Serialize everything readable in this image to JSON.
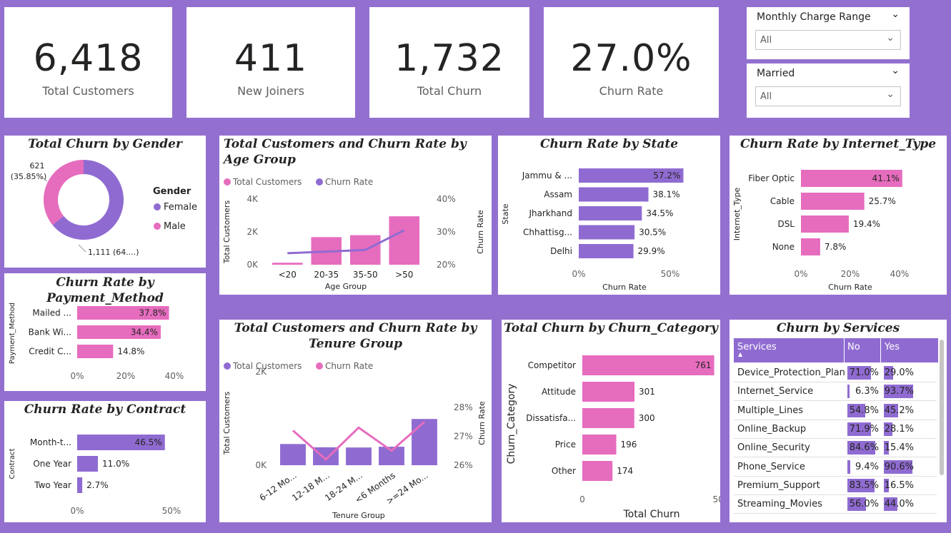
{
  "kpis": [
    {
      "value": "6,418",
      "label": "Total Customers"
    },
    {
      "value": "411",
      "label": "New Joiners"
    },
    {
      "value": "1,732",
      "label": "Total Churn"
    },
    {
      "value": "27.0%",
      "label": "Churn Rate"
    }
  ],
  "slicers": [
    {
      "title": "Monthly Charge Range",
      "value": "All"
    },
    {
      "title": "Married",
      "value": "All"
    }
  ],
  "colors": {
    "purple": "#8f6bd1",
    "pink": "#e66cbe",
    "background": "#9370D0"
  },
  "chart_data": [
    {
      "id": "gender",
      "type": "pie",
      "title": "Total Churn by Gender",
      "legend_title": "Gender",
      "legend_position": "right",
      "slices": [
        {
          "name": "Female",
          "value": 1111,
          "label": "1,111 (64....)",
          "color": "#8f6bd1"
        },
        {
          "name": "Male",
          "value": 621,
          "label": "621 (35.85%)",
          "color": "#e66cbe"
        }
      ]
    },
    {
      "id": "payment",
      "type": "bar",
      "orientation": "horizontal",
      "title": "Churn Rate by Payment_Method",
      "ylabel": "Payment_Method",
      "categories": [
        "Mailed ...",
        "Bank Wi...",
        "Credit C..."
      ],
      "values": [
        37.8,
        34.4,
        14.8
      ],
      "labels": [
        "37.8%",
        "34.4%",
        "14.8%"
      ],
      "xticks": [
        "0%",
        "20%",
        "40%"
      ],
      "xlim": [
        0,
        40
      ],
      "color": "#e66cbe"
    },
    {
      "id": "contract",
      "type": "bar",
      "orientation": "horizontal",
      "title": "Churn Rate by Contract",
      "ylabel": "Contract",
      "categories": [
        "Month-t...",
        "One Year",
        "Two Year"
      ],
      "values": [
        46.5,
        11.0,
        2.7
      ],
      "labels": [
        "46.5%",
        "11.0%",
        "2.7%"
      ],
      "xticks": [
        "0%",
        "50%"
      ],
      "xlim": [
        0,
        50
      ],
      "color": "#8f6bd1"
    },
    {
      "id": "age",
      "type": "bar",
      "title": "Total Customers and Churn Rate by Age Group",
      "legend": [
        {
          "name": "Total Customers",
          "color": "#e66cbe"
        },
        {
          "name": "Churn Rate",
          "color": "#8f6bd1"
        }
      ],
      "xlabel": "Age Group",
      "ylabel": "Total Customers",
      "y2label": "Churn Rate",
      "categories": [
        "<20",
        "20-35",
        "35-50",
        ">50"
      ],
      "series": [
        {
          "name": "Total Customers",
          "kind": "bar",
          "values": [
            120,
            1680,
            1800,
            2950
          ],
          "color": "#e66cbe"
        },
        {
          "name": "Churn Rate",
          "kind": "line",
          "values": [
            23.5,
            24.0,
            24.5,
            30.5
          ],
          "color": "#8f6bd1"
        }
      ],
      "yticks": [
        "0K",
        "2K",
        "4K"
      ],
      "ylim": [
        0,
        4000
      ],
      "y2ticks": [
        "20%",
        "30%",
        "40%"
      ],
      "y2lim": [
        20,
        40
      ]
    },
    {
      "id": "tenure",
      "type": "bar",
      "title": "Total Customers and Churn Rate by Tenure Group",
      "legend": [
        {
          "name": "Total Customers",
          "color": "#8f6bd1"
        },
        {
          "name": "Churn Rate",
          "color": "#e66cbe"
        }
      ],
      "xlabel": "Tenure Group",
      "ylabel": "Total Customers",
      "y2label": "Churn Rate",
      "categories": [
        "6-12 Mo...",
        "12-18 M...",
        "18-24 M...",
        "<6 Months",
        ">=24 Mo..."
      ],
      "series": [
        {
          "name": "Total Customers",
          "kind": "bar",
          "values": [
            1100,
            930,
            920,
            960,
            2400
          ],
          "color": "#8f6bd1"
        },
        {
          "name": "Churn Rate",
          "kind": "line",
          "values": [
            27.2,
            26.2,
            27.3,
            26.5,
            27.5
          ],
          "color": "#e66cbe"
        }
      ],
      "yticks": [
        "0K",
        "2K"
      ],
      "ylim": [
        0,
        3000
      ],
      "y2ticks": [
        "26%",
        "27%",
        "28%"
      ],
      "y2lim": [
        26,
        28
      ]
    },
    {
      "id": "state",
      "type": "bar",
      "orientation": "horizontal",
      "title": "Churn Rate by State",
      "xlabel": "Churn Rate",
      "ylabel": "State",
      "categories": [
        "Jammu & ...",
        "Assam",
        "Jharkhand",
        "Chhattisg...",
        "Delhi"
      ],
      "values": [
        57.2,
        38.1,
        34.5,
        30.5,
        29.9
      ],
      "labels": [
        "57.2%",
        "38.1%",
        "34.5%",
        "30.5%",
        "29.9%"
      ],
      "xticks": [
        "0%",
        "50%"
      ],
      "xlim": [
        0,
        50
      ],
      "color": "#8f6bd1"
    },
    {
      "id": "internet",
      "type": "bar",
      "orientation": "horizontal",
      "title": "Churn Rate by Internet_Type",
      "xlabel": "Churn Rate",
      "ylabel": "Internet_Type",
      "categories": [
        "Fiber Optic",
        "Cable",
        "DSL",
        "None"
      ],
      "values": [
        41.1,
        25.7,
        19.4,
        7.8
      ],
      "labels": [
        "41.1%",
        "25.7%",
        "19.4%",
        "7.8%"
      ],
      "xticks": [
        "0%",
        "20%",
        "40%"
      ],
      "xlim": [
        0,
        40
      ],
      "color": "#e66cbe"
    },
    {
      "id": "category",
      "type": "bar",
      "orientation": "horizontal",
      "title": "Total Churn by Churn_Category",
      "xlabel": "Total Churn",
      "ylabel": "Churn_Category",
      "categories": [
        "Competitor",
        "Attitude",
        "Dissatisfa...",
        "Price",
        "Other"
      ],
      "values": [
        761,
        301,
        300,
        196,
        174
      ],
      "labels": [
        "761",
        "301",
        "300",
        "196",
        "174"
      ],
      "xticks": [
        "0",
        "500"
      ],
      "xlim": [
        0,
        800
      ],
      "color": "#e66cbe"
    },
    {
      "id": "services",
      "type": "table",
      "title": "Churn by Services",
      "columns": [
        "Services",
        "No",
        "Yes"
      ],
      "rows": [
        {
          "service": "Device_Protection_Plan",
          "no": 71.0,
          "yes": 29.0,
          "no_label": "71.0%",
          "yes_label": "29.0%"
        },
        {
          "service": "Internet_Service",
          "no": 6.3,
          "yes": 93.7,
          "no_label": "6.3%",
          "yes_label": "93.7%"
        },
        {
          "service": "Multiple_Lines",
          "no": 54.8,
          "yes": 45.2,
          "no_label": "54.8%",
          "yes_label": "45.2%"
        },
        {
          "service": "Online_Backup",
          "no": 71.9,
          "yes": 28.1,
          "no_label": "71.9%",
          "yes_label": "28.1%"
        },
        {
          "service": "Online_Security",
          "no": 84.6,
          "yes": 15.4,
          "no_label": "84.6%",
          "yes_label": "15.4%"
        },
        {
          "service": "Phone_Service",
          "no": 9.4,
          "yes": 90.6,
          "no_label": "9.4%",
          "yes_label": "90.6%"
        },
        {
          "service": "Premium_Support",
          "no": 83.5,
          "yes": 16.5,
          "no_label": "83.5%",
          "yes_label": "16.5%"
        },
        {
          "service": "Streaming_Movies",
          "no": 56.0,
          "yes": 44.0,
          "no_label": "56.0%",
          "yes_label": "44.0%"
        }
      ]
    }
  ]
}
